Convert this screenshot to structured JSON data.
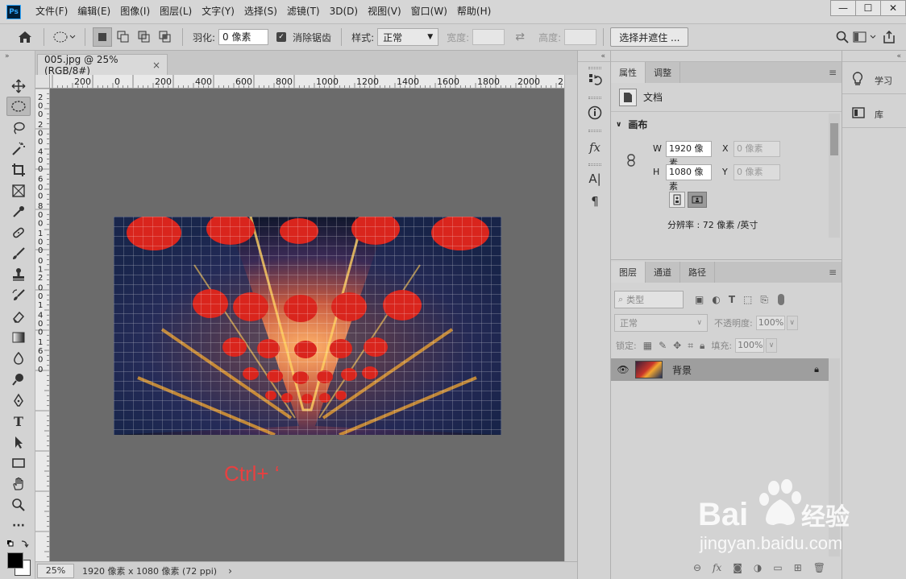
{
  "app": {
    "logo_text": "Ps",
    "menu": [
      "文件(F)",
      "编辑(E)",
      "图像(I)",
      "图层(L)",
      "文字(Y)",
      "选择(S)",
      "滤镜(T)",
      "3D(D)",
      "视图(V)",
      "窗口(W)",
      "帮助(H)"
    ],
    "window_controls": [
      "—",
      "☐",
      "✕"
    ]
  },
  "options": {
    "feather_label": "羽化:",
    "feather_value": "0 像素",
    "antialias_label": "消除锯齿",
    "antialias_checked": true,
    "style_label": "样式:",
    "style_value": "正常",
    "width_label": "宽度:",
    "height_label": "高度:",
    "select_mask_button": "选择并遮住 ..."
  },
  "document": {
    "tab_title": "005.jpg @ 25%(RGB/8#)",
    "tab_close": "×",
    "ruler_top_labels": [
      "200",
      "0",
      "200",
      "400",
      "600",
      "800",
      "1000",
      "1200",
      "1400",
      "1600",
      "1800",
      "2000",
      "2"
    ],
    "ruler_left_labels": [
      "2",
      "0",
      "0",
      "2",
      "0",
      "0",
      "4",
      "0",
      "0",
      "6",
      "0",
      "0",
      "8",
      "0",
      "0",
      "1",
      "0",
      "0",
      "0",
      "1",
      "2",
      "0",
      "0",
      "1",
      "4",
      "0",
      "0",
      "1",
      "6",
      "0",
      "0"
    ],
    "zoom": "25%",
    "info": "1920 像素 x 1080 像素 (72 ppi)",
    "info_arrow": "›",
    "hint_text": "Ctrl+ ‘"
  },
  "properties": {
    "tabs": [
      "属性",
      "调整"
    ],
    "doc_label": "文档",
    "section_title": "画布",
    "w_label": "W",
    "w_value": "1920 像素",
    "h_label": "H",
    "h_value": "1080 像素",
    "x_label": "X",
    "x_value": "0 像素",
    "y_label": "Y",
    "y_value": "0 像素",
    "resolution": "分辨率 : 72 像素 /英寸"
  },
  "layers": {
    "tabs": [
      "图层",
      "通道",
      "路径"
    ],
    "filter_placeholder": "类型",
    "blend_mode": "正常",
    "opacity_label": "不透明度:",
    "opacity_value": "100%",
    "lock_label": "锁定:",
    "fill_label": "填充:",
    "fill_value": "100%",
    "layer_name": "背景"
  },
  "side_panels": {
    "learn": "学习",
    "library": "库"
  },
  "watermark": {
    "brand": "Bai",
    "brand2": "经验",
    "url": "jingyan.baidu.com"
  },
  "colors": {
    "canvas_bg": "#6b6b6b",
    "hint_red": "#e84040",
    "ps_blue": "#31a8ff"
  }
}
